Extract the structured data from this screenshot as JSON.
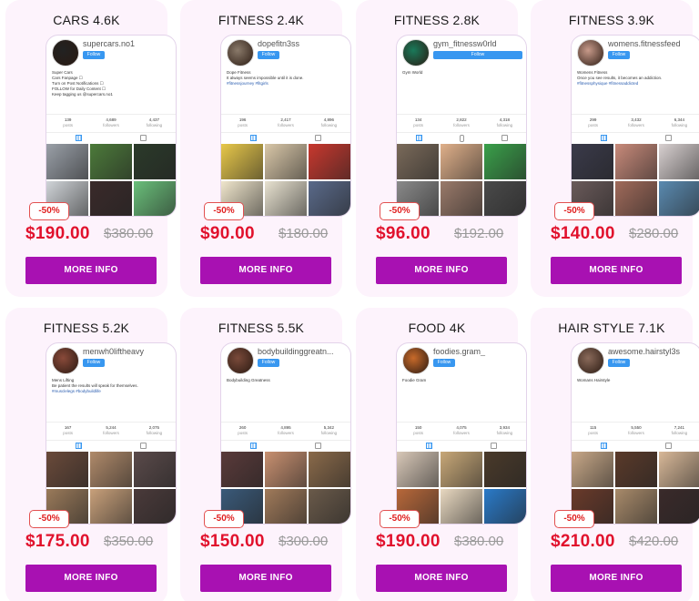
{
  "listings": [
    {
      "title": "CARS 4.6K",
      "username": "supercars.no1",
      "follow": "Follow",
      "bio": [
        "Super Cars",
        "Cars Fanpage ☐",
        "Turn on Post Notifications ☐",
        "FOLLOW for Daily Content ☐",
        "Keep tagging us @supercars.no1"
      ],
      "tags": "",
      "stats": [
        {
          "n": "139",
          "l": "posts"
        },
        {
          "n": "4,689",
          "l": "followers"
        },
        {
          "n": "4,437",
          "l": "following"
        }
      ],
      "discount": "-50%",
      "price": "$190.00",
      "old_price": "$380.00",
      "cta": "MORE INFO",
      "photo_colors": [
        "#9aa0a8",
        "#4c7a3a",
        "#2b3a2a",
        "#d0d4d8",
        "#3a2a2a",
        "#6abf7a"
      ],
      "avatar_color": "#222222",
      "wide_follow": false
    },
    {
      "title": "FITNESS 2.4K",
      "username": "dopefitn3ss",
      "follow": "Follow",
      "bio": [
        "Dope Fitness",
        "It always seems impossible until it is done."
      ],
      "tags": "#fitnessjourney #fitgirls",
      "stats": [
        {
          "n": "196",
          "l": "posts"
        },
        {
          "n": "2,417",
          "l": "followers"
        },
        {
          "n": "4,896",
          "l": "following"
        }
      ],
      "discount": "-50%",
      "price": "$90.00",
      "old_price": "$180.00",
      "cta": "MORE INFO",
      "photo_colors": [
        "#e8c84a",
        "#d9c7a8",
        "#c8382e",
        "#f0e6cc",
        "#e8e2d0",
        "#5a6a8a"
      ],
      "avatar_color": "#8a7a6a",
      "wide_follow": false
    },
    {
      "title": "FITNESS 2.8K",
      "username": "gym_fitnessw0rld",
      "follow": "Follow",
      "bio": [
        "Gym World"
      ],
      "tags": "",
      "stats": [
        {
          "n": "134",
          "l": "posts"
        },
        {
          "n": "2,822",
          "l": "followers"
        },
        {
          "n": "4,318",
          "l": "following"
        }
      ],
      "discount": "-50%",
      "price": "$96.00",
      "old_price": "$192.00",
      "cta": "MORE INFO",
      "photo_colors": [
        "#7a6a5a",
        "#e0b08a",
        "#3aa04a",
        "#8a8a8a",
        "#9a7a6a",
        "#4a4a4a"
      ],
      "avatar_color": "#1a7a5a",
      "wide_follow": true
    },
    {
      "title": "FITNESS 3.9K",
      "username": "womens.fitnessfeed",
      "follow": "Follow",
      "bio": [
        "Womens Fitness",
        "Once you see results, it becomes an addiction."
      ],
      "tags": "#fitnessphysique #fitnessaddicted",
      "stats": [
        {
          "n": "299",
          "l": "posts"
        },
        {
          "n": "3,432",
          "l": "followers"
        },
        {
          "n": "6,344",
          "l": "following"
        }
      ],
      "discount": "-50%",
      "price": "$140.00",
      "old_price": "$280.00",
      "cta": "MORE INFO",
      "photo_colors": [
        "#3a3a4a",
        "#c88a7a",
        "#d8d0d0",
        "#6a5a5a",
        "#a06a5a",
        "#5a8ab0"
      ],
      "avatar_color": "#c89a8a",
      "wide_follow": false
    },
    {
      "title": "FITNESS 5.2K",
      "username": "menwh0liftheavy",
      "follow": "Follow",
      "bio": [
        "Mens Lifting",
        "Be patient the results will speak for themselves."
      ],
      "tags": "#musclelegs #bodybuildlife",
      "stats": [
        {
          "n": "167",
          "l": "posts"
        },
        {
          "n": "5,244",
          "l": "followers"
        },
        {
          "n": "2,075",
          "l": "following"
        }
      ],
      "discount": "-50%",
      "price": "$175.00",
      "old_price": "$350.00",
      "cta": "MORE INFO",
      "photo_colors": [
        "#6a4a3a",
        "#b08a6a",
        "#5a4a4a",
        "#9a7a5a",
        "#c8a07a",
        "#4a3a3a"
      ],
      "avatar_color": "#8a4a3a",
      "wide_follow": false
    },
    {
      "title": "FITNESS 5.5K",
      "username": "bodybuildinggreatn...",
      "follow": "Follow",
      "bio": [
        "Bodybuilding Greatness"
      ],
      "tags": "",
      "stats": [
        {
          "n": "260",
          "l": "posts"
        },
        {
          "n": "4,895",
          "l": "followers"
        },
        {
          "n": "5,342",
          "l": "following"
        }
      ],
      "discount": "-50%",
      "price": "$150.00",
      "old_price": "$300.00",
      "cta": "MORE INFO",
      "photo_colors": [
        "#5a3a3a",
        "#c89070",
        "#8a6a4a",
        "#3a5a7a",
        "#a07a5a",
        "#6a5a4a"
      ],
      "avatar_color": "#7a4a3a",
      "wide_follow": false
    },
    {
      "title": "FOOD 4K",
      "username": "foodies.gram_",
      "follow": "Follow",
      "bio": [
        "Foodie Gram"
      ],
      "tags": "",
      "stats": [
        {
          "n": "150",
          "l": "posts"
        },
        {
          "n": "4,075",
          "l": "followers"
        },
        {
          "n": "3,934",
          "l": "following"
        }
      ],
      "discount": "-50%",
      "price": "$190.00",
      "old_price": "$380.00",
      "cta": "MORE INFO",
      "photo_colors": [
        "#d8c8b8",
        "#c8a878",
        "#4a3a2a",
        "#b8683a",
        "#e8d8c0",
        "#2a7ac8"
      ],
      "avatar_color": "#c86a2a",
      "wide_follow": false
    },
    {
      "title": "HAIR STYLE 7.1K",
      "username": "awesome.hairstyl3s",
      "follow": "Follow",
      "bio": [
        "Womans Hairstyle"
      ],
      "tags": "",
      "stats": [
        {
          "n": "115",
          "l": "posts"
        },
        {
          "n": "5,550",
          "l": "followers"
        },
        {
          "n": "7,241",
          "l": "following"
        }
      ],
      "discount": "-50%",
      "price": "$210.00",
      "old_price": "$420.00",
      "cta": "MORE INFO",
      "photo_colors": [
        "#c8a888",
        "#5a3a2a",
        "#d8b898",
        "#6a3a2a",
        "#a88a6a",
        "#3a2a2a"
      ],
      "avatar_color": "#8a6a5a",
      "wide_follow": false
    }
  ]
}
